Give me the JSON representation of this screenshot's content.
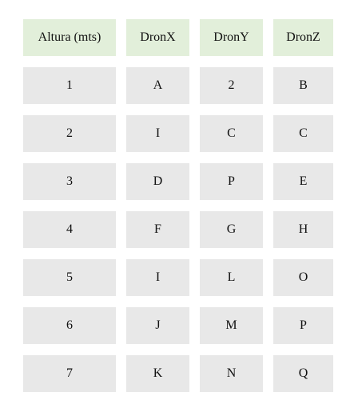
{
  "table": {
    "headers": [
      "Altura (mts)",
      "DronX",
      "DronY",
      "DronZ"
    ],
    "rows": [
      [
        "1",
        "A",
        "2",
        "B"
      ],
      [
        "2",
        "I",
        "C",
        "C"
      ],
      [
        "3",
        "D",
        "P",
        "E"
      ],
      [
        "4",
        "F",
        "G",
        "H"
      ],
      [
        "5",
        "I",
        "L",
        "O"
      ],
      [
        "6",
        "J",
        "M",
        "P"
      ],
      [
        "7",
        "K",
        "N",
        "Q"
      ]
    ]
  },
  "colors": {
    "header_bg": "#e2efda",
    "cell_bg": "#e8e8e8"
  }
}
